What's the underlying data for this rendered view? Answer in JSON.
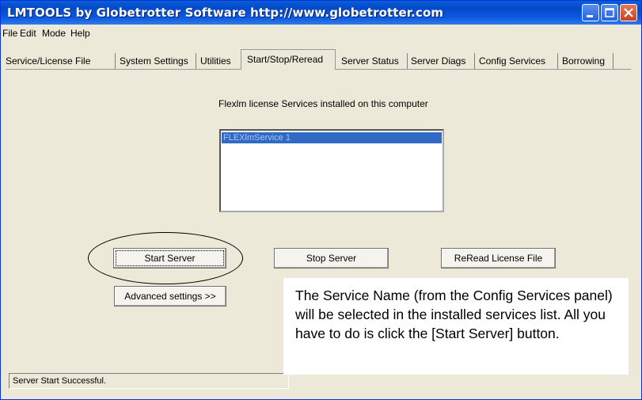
{
  "window": {
    "title": "LMTOOLS by Globetrotter Software http://www.globetrotter.com"
  },
  "titlebar": {
    "minimize_icon": "minimize-icon",
    "maximize_icon": "maximize-icon",
    "close_icon": "close-icon"
  },
  "menu": [
    "File",
    "Edit",
    "Mode",
    "Help"
  ],
  "tabs": [
    "Service/License File",
    "System Settings",
    "Utilities",
    "Start/Stop/Reread",
    "Server Status",
    "Server Diags",
    "Config Services",
    "Borrowing"
  ],
  "active_tab": "Start/Stop/Reread",
  "panel": {
    "heading": "Flexlm license Services installed on this computer",
    "services": [
      "FLEXlmService 1"
    ],
    "selected_service": "FLEXlmService 1"
  },
  "buttons": {
    "start": "Start Server",
    "stop": "Stop Server",
    "reread": "ReRead License File",
    "advanced": "Advanced settings >>"
  },
  "callout": "The Service Name (from the Config Services panel) will be selected in the installed services list.  All you have to do is click the [Start Server] button.",
  "status": "Server Start Successful.",
  "colors": {
    "titlebar": "#0a5fd8",
    "selection": "#316ac5",
    "window_bg": "#ece9d8"
  }
}
